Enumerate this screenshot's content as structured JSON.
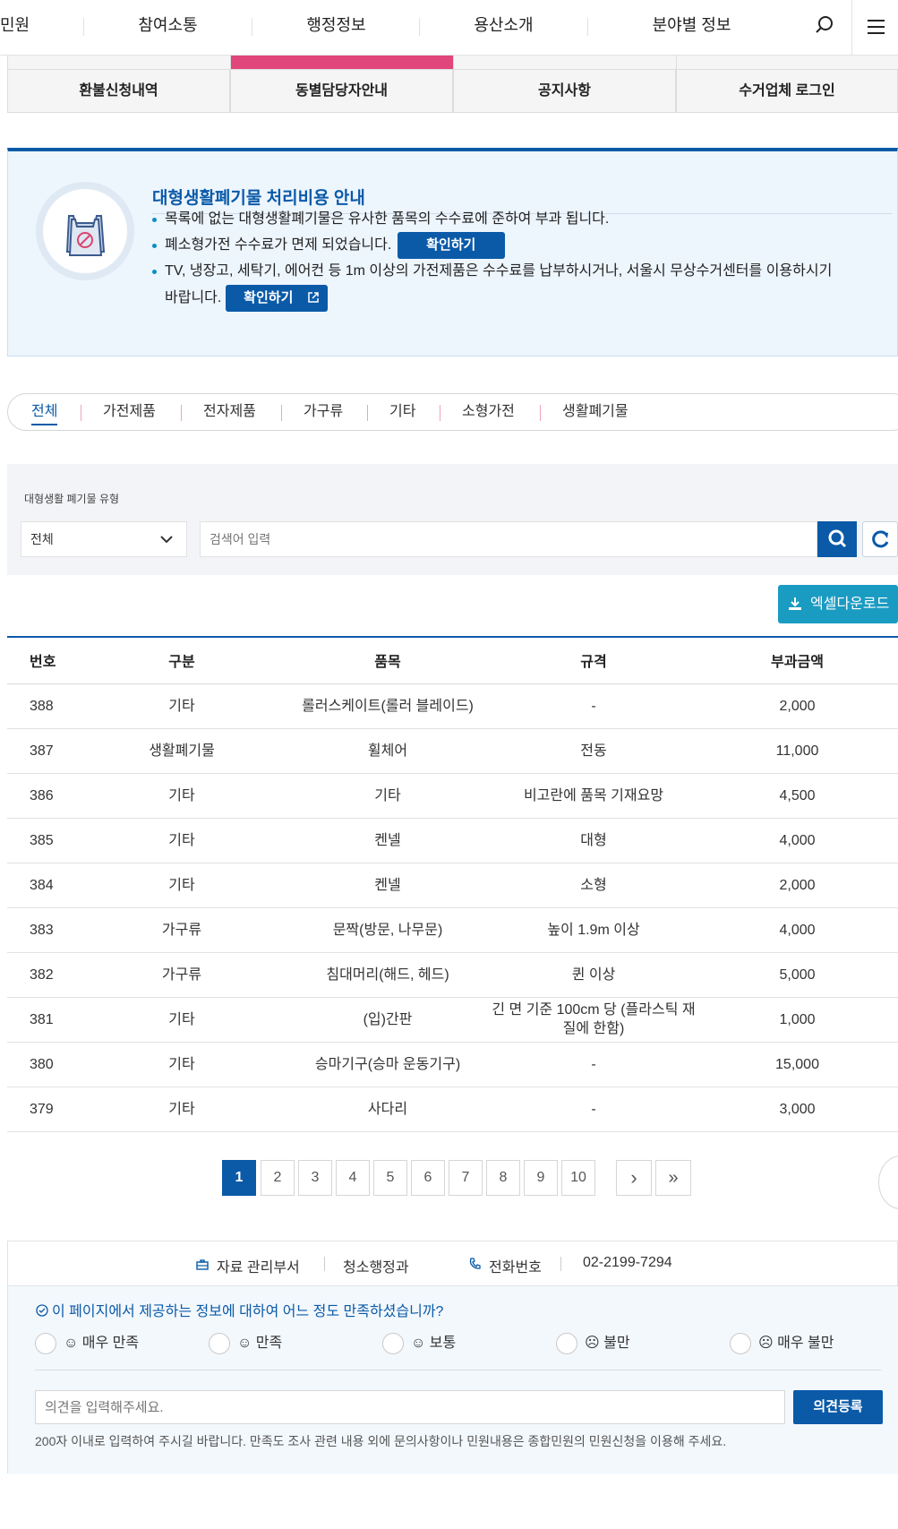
{
  "nav": {
    "items": [
      "민원",
      "참여소통",
      "행정정보",
      "용산소개",
      "분야별 정보"
    ],
    "search_icon": "search-icon",
    "menu_icon": "hamburger-icon"
  },
  "subtabs": [
    "환불신청내역",
    "동별담당자안내",
    "공지사항",
    "수거업체 로그인"
  ],
  "info": {
    "title": "대형생활폐기물 처리비용 안내",
    "bullets": [
      "목록에 없는 대형생활폐기물은 유사한 품목의 수수료에 준하여 부과 됩니다.",
      "폐소형가전 수수료가 면제 되었습니다.",
      "TV, 냉장고, 세탁기, 에어컨 등 1m 이상의 가전제품은 수수료를 납부하시거나, 서울시 무상수거센터를 이용하시기",
      "바랍니다."
    ],
    "confirm_label": "확인하기",
    "icon": "waste-bag-icon"
  },
  "categories": [
    "전체",
    "가전제품",
    "전자제품",
    "가구류",
    "기타",
    "소형가전",
    "생활폐기물"
  ],
  "search": {
    "label": "대형생활 폐기물 유형",
    "select_value": "전체",
    "placeholder": "검색어 입력"
  },
  "excel_label": "엑셀다운로드",
  "table": {
    "headers": [
      "번호",
      "구분",
      "품목",
      "규격",
      "부과금액"
    ],
    "rows": [
      [
        "388",
        "기타",
        "롤러스케이트(롤러 블레이드)",
        "-",
        "2,000"
      ],
      [
        "387",
        "생활폐기물",
        "휠체어",
        "전동",
        "11,000"
      ],
      [
        "386",
        "기타",
        "기타",
        "비고란에 품목 기재요망",
        "4,500"
      ],
      [
        "385",
        "기타",
        "켄넬",
        "대형",
        "4,000"
      ],
      [
        "384",
        "기타",
        "켄넬",
        "소형",
        "2,000"
      ],
      [
        "383",
        "가구류",
        "문짝(방문, 나무문)",
        "높이 1.9m 이상",
        "4,000"
      ],
      [
        "382",
        "가구류",
        "침대머리(해드, 헤드)",
        "퀸 이상",
        "5,000"
      ],
      [
        "381",
        "기타",
        "(입)간판",
        "긴 면 기준 100cm 당 (플라스틱 재질에 한함)",
        "1,000"
      ],
      [
        "380",
        "기타",
        "승마기구(승마 운동기구)",
        "-",
        "15,000"
      ],
      [
        "379",
        "기타",
        "사다리",
        "-",
        "3,000"
      ]
    ]
  },
  "pagination": {
    "pages": [
      "1",
      "2",
      "3",
      "4",
      "5",
      "6",
      "7",
      "8",
      "9",
      "10"
    ],
    "current": "1",
    "next": "›",
    "last": "»"
  },
  "feedback": {
    "dept_label": "자료 관리부서",
    "dept_value": "청소행정과",
    "phone_label": "전화번호",
    "phone_value": "02-2199-7294",
    "question": "이 페이지에서 제공하는 정보에 대하여 어느 정도 만족하셨습니까?",
    "options": [
      "☺ 매우 만족",
      "☺ 만족",
      "☺ 보통",
      "☹ 불만",
      "☹ 매우 불만"
    ],
    "placeholder": "의견을 입력해주세요.",
    "submit_label": "의견등록",
    "note": "200자 이내로 입력하여 주시길 바랍니다. 만족도 조사 관련 내용 외에 문의사항이나 민원내용은 종합민원의 민원신청을 이용해 주세요."
  }
}
